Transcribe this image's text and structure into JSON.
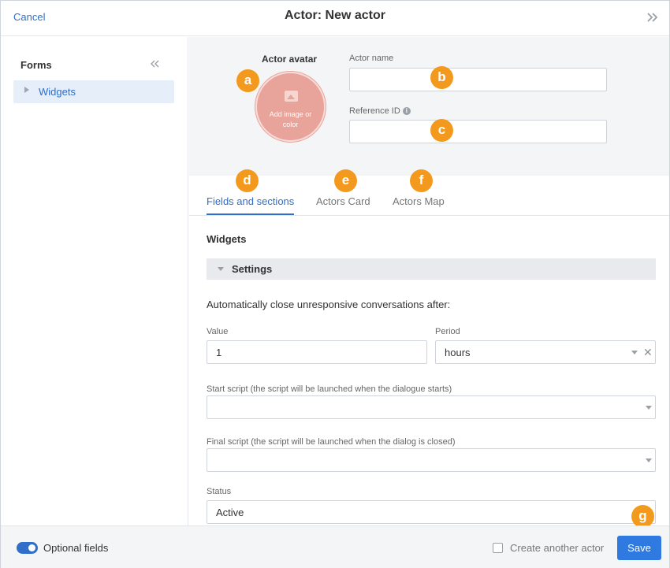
{
  "header": {
    "cancel_label": "Cancel",
    "title": "Actor: New actor",
    "expand_icon": "double-chevron-right-icon"
  },
  "sidebar": {
    "title": "Forms",
    "collapse_icon": "double-chevron-left-icon",
    "items": [
      {
        "label": "Widgets"
      }
    ]
  },
  "top_panel": {
    "avatar_label": "Actor avatar",
    "avatar_text": "Add image or color",
    "avatar_color": "#e8a39a",
    "actor_name_label": "Actor name",
    "actor_name_value": "",
    "reference_id_label": "Reference ID",
    "reference_id_value": ""
  },
  "badges": {
    "a": "a",
    "b": "b",
    "c": "c",
    "d": "d",
    "e": "e",
    "f": "f",
    "g": "g",
    "color": "#f39a1e"
  },
  "tabs": [
    {
      "label": "Fields and sections",
      "active": true
    },
    {
      "label": "Actors Card",
      "active": false
    },
    {
      "label": "Actors Map",
      "active": false
    }
  ],
  "content": {
    "section_title": "Widgets",
    "settings_label": "Settings",
    "description": "Automatically close unresponsive conversations after:",
    "value_label": "Value",
    "value": "1",
    "period_label": "Period",
    "period_value": "hours",
    "start_script_label": "Start script (the script will be launched when the dialogue starts)",
    "start_script_value": "",
    "final_script_label": "Final script (the script will be launched when the dialog is closed)",
    "final_script_value": "",
    "status_label": "Status",
    "status_value": "Active"
  },
  "footer": {
    "optional_fields_label": "Optional fields",
    "optional_fields_on": true,
    "create_another_label": "Create another actor",
    "save_label": "Save"
  },
  "colors": {
    "accent": "#2f6ec9",
    "save_button": "#2f7ae0"
  }
}
